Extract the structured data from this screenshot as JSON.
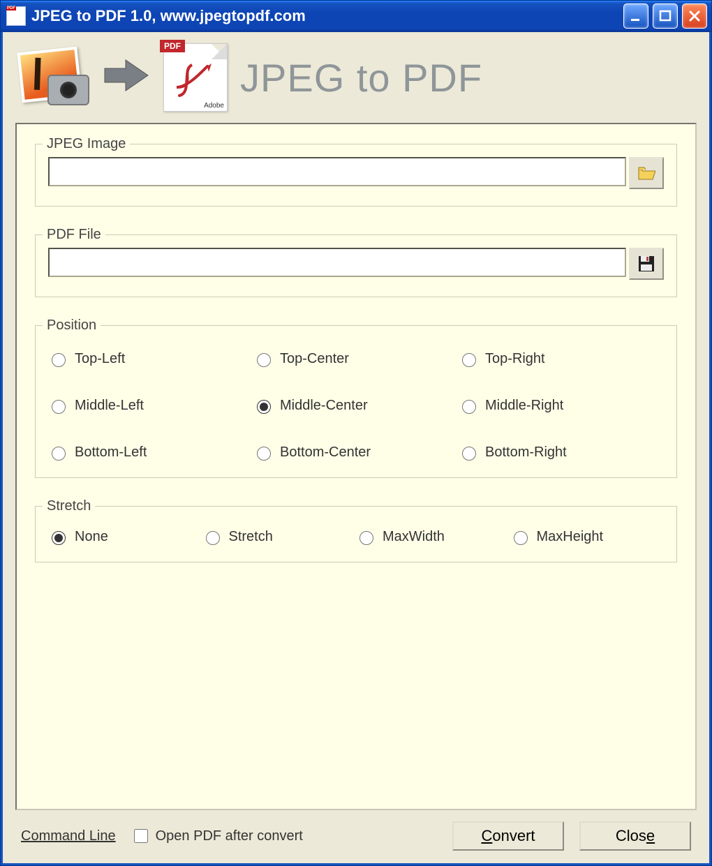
{
  "window": {
    "title": "JPEG to PDF 1.0, www.jpegtopdf.com"
  },
  "header": {
    "pdf_badge": "PDF",
    "adobe_label": "Adobe",
    "heading": "JPEG to PDF"
  },
  "jpeg_group": {
    "legend": "JPEG Image",
    "value": ""
  },
  "pdf_group": {
    "legend": "PDF File",
    "value": ""
  },
  "position": {
    "legend": "Position",
    "options": [
      "Top-Left",
      "Top-Center",
      "Top-Right",
      "Middle-Left",
      "Middle-Center",
      "Middle-Right",
      "Bottom-Left",
      "Bottom-Center",
      "Bottom-Right"
    ],
    "selected": "Middle-Center"
  },
  "stretch": {
    "legend": "Stretch",
    "options": [
      "None",
      "Stretch",
      "MaxWidth",
      "MaxHeight"
    ],
    "selected": "None"
  },
  "footer": {
    "command_line": "Command Line",
    "open_after": "Open PDF after convert",
    "open_after_checked": false,
    "convert": "Convert",
    "convert_accel": "C",
    "close": "Close",
    "close_accel": "e"
  }
}
